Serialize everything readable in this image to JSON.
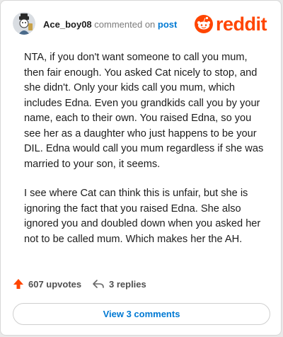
{
  "comment": {
    "username": "Ace_boy08",
    "action_text": "commented on",
    "post_link": "post",
    "paragraphs": [
      "NTA, if you don't want someone to call you mum, then fair enough. You asked Cat nicely to stop, and she didn't. Only your kids call you mum, which includes Edna. Even you grandkids call you by your name, each to their own. You raised Edna, so you see her as a daughter who just happens to be your DIL. Edna would call you mum regardless if she was married to your son, it seems.",
      "I see where Cat can think this is unfair, but she is ignoring the fact that you raised Edna. She also ignored you and doubled down when you asked her not to be called mum. Which makes her the AH."
    ]
  },
  "brand": {
    "name": "reddit",
    "color": "#ff4500",
    "icon": "reddit-snoo-icon"
  },
  "stats": {
    "upvotes": "607 upvotes",
    "replies": "3 replies",
    "upvote_icon": "upvote-arrow-icon",
    "reply_icon": "reply-arrow-icon"
  },
  "view_button": {
    "label": "View 3 comments"
  },
  "colors": {
    "upvote": "#ff4500",
    "link": "#0079d3",
    "text": "#1c1c1c",
    "muted": "#7c7c7c"
  }
}
